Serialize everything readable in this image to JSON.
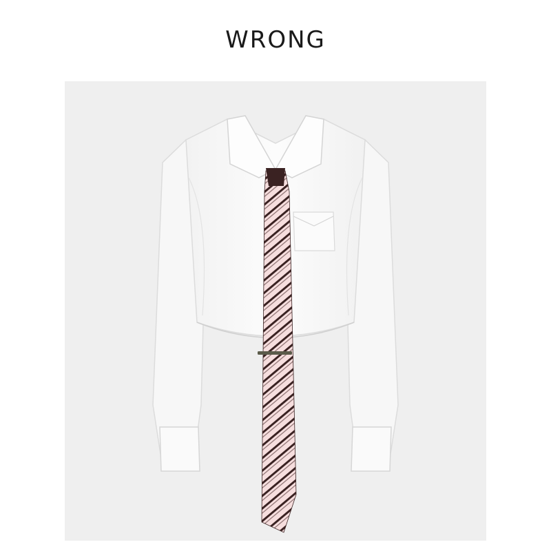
{
  "brand": {
    "name": "WRONG"
  },
  "product_image": {
    "subject": "white-cropped-shirt-with-striped-tie",
    "background_color": "#efefef",
    "shirt_color": "#fbfbfb",
    "tie_base_color": "#f6dede",
    "tie_stripe_color": "#3a2222"
  }
}
